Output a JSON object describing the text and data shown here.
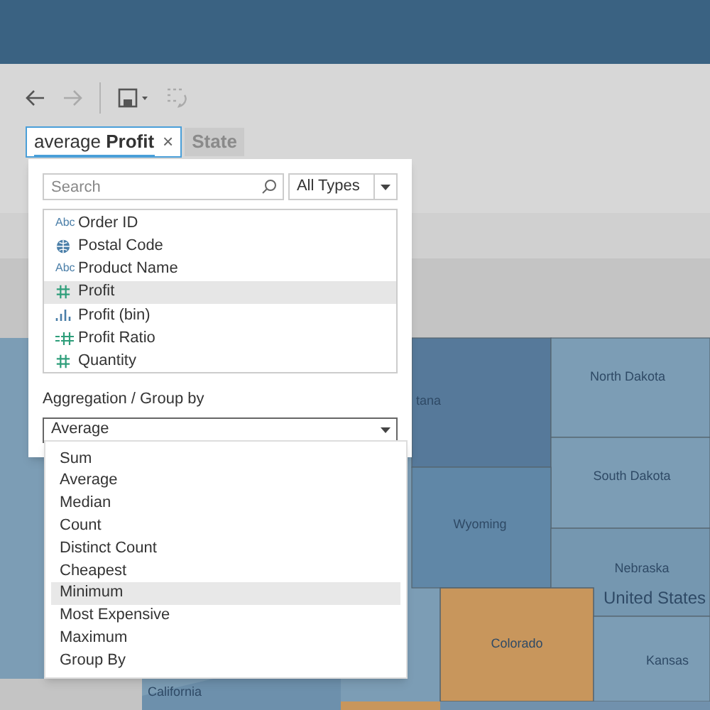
{
  "toolbar": {
    "back": {
      "disabled": false
    },
    "forward": {
      "disabled": true
    },
    "redo": {
      "disabled": true
    }
  },
  "pills": [
    {
      "kind": "editing",
      "text": "average **Profit**",
      "close": "×"
    },
    {
      "kind": "field",
      "text": "State"
    }
  ],
  "field_picker": {
    "search": {
      "placeholder": "Search"
    },
    "type_filter": "All Types",
    "fields": [
      {
        "label": "Order ID",
        "kind": "string",
        "icon_text": "Abc",
        "selected": false
      },
      {
        "label": "Postal Code",
        "kind": "geo",
        "selected": false
      },
      {
        "label": "Product Name",
        "kind": "string",
        "icon_text": "Abc",
        "selected": false
      },
      {
        "label": "Profit",
        "kind": "number",
        "selected": true
      },
      {
        "label": "Profit (bin)",
        "kind": "bin",
        "selected": false
      },
      {
        "label": "Profit Ratio",
        "kind": "calc",
        "selected": false
      },
      {
        "label": "Quantity",
        "kind": "number",
        "selected": false
      }
    ],
    "aggregation_label": "Aggregation / Group by",
    "aggregation_value": "Average",
    "options": [
      {
        "label": "Sum",
        "selected": false
      },
      {
        "label": "Average",
        "selected": false
      },
      {
        "label": "Median",
        "selected": false
      },
      {
        "label": "Count",
        "selected": false
      },
      {
        "label": "Distinct Count",
        "selected": false
      },
      {
        "label": "Cheapest",
        "selected": false
      },
      {
        "label": "Minimum",
        "selected": true
      },
      {
        "label": "Most Expensive",
        "selected": false
      },
      {
        "label": "Maximum",
        "selected": false
      },
      {
        "label": "Group By",
        "selected": false
      }
    ]
  },
  "map": {
    "labels": [
      "tana",
      "North Dakota",
      "South Dakota",
      "Wyoming",
      "Nebraska",
      "United States",
      "Colorado",
      "Kansas",
      "California"
    ]
  }
}
